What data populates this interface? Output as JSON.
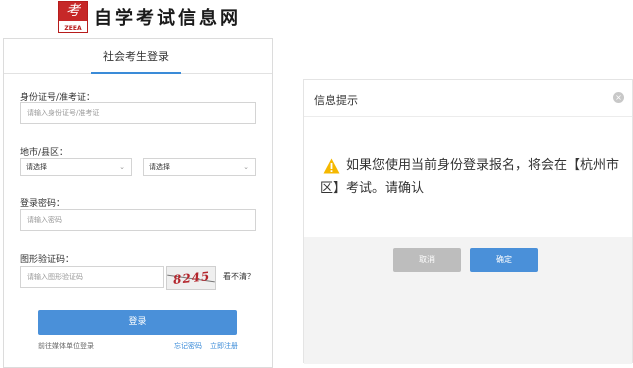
{
  "header": {
    "logo_text": "考",
    "logo_brand": "ZEEA",
    "site_name": "自学考试信息网"
  },
  "login": {
    "tab_label": "社会考生登录",
    "id_label": "身份证号/准考证：",
    "id_placeholder": "请输入身份证号/准考证",
    "region_label": "地市/县区：",
    "city_value": "请选择",
    "district_value": "请选择",
    "password_label": "登录密码：",
    "password_placeholder": "请输入密码",
    "captcha_label": "图形验证码：",
    "captcha_placeholder": "请输入图形验证码",
    "captcha_code": "8245",
    "refresh_text": "看不清？",
    "login_button": "登录",
    "unit_login_link": "前往媒体单位登录",
    "forgot_link": "忘记密码",
    "register_link": "立即注册"
  },
  "dialog": {
    "title": "信息提示",
    "close_symbol": "×",
    "message": "如果您使用当前身份登录报名，将会在【杭州市区】考试。请确认",
    "cancel_label": "取消",
    "confirm_label": "确定"
  },
  "colors": {
    "accent": "#4a90d9",
    "warning": "#f5b800",
    "brand_red": "#c62828"
  }
}
